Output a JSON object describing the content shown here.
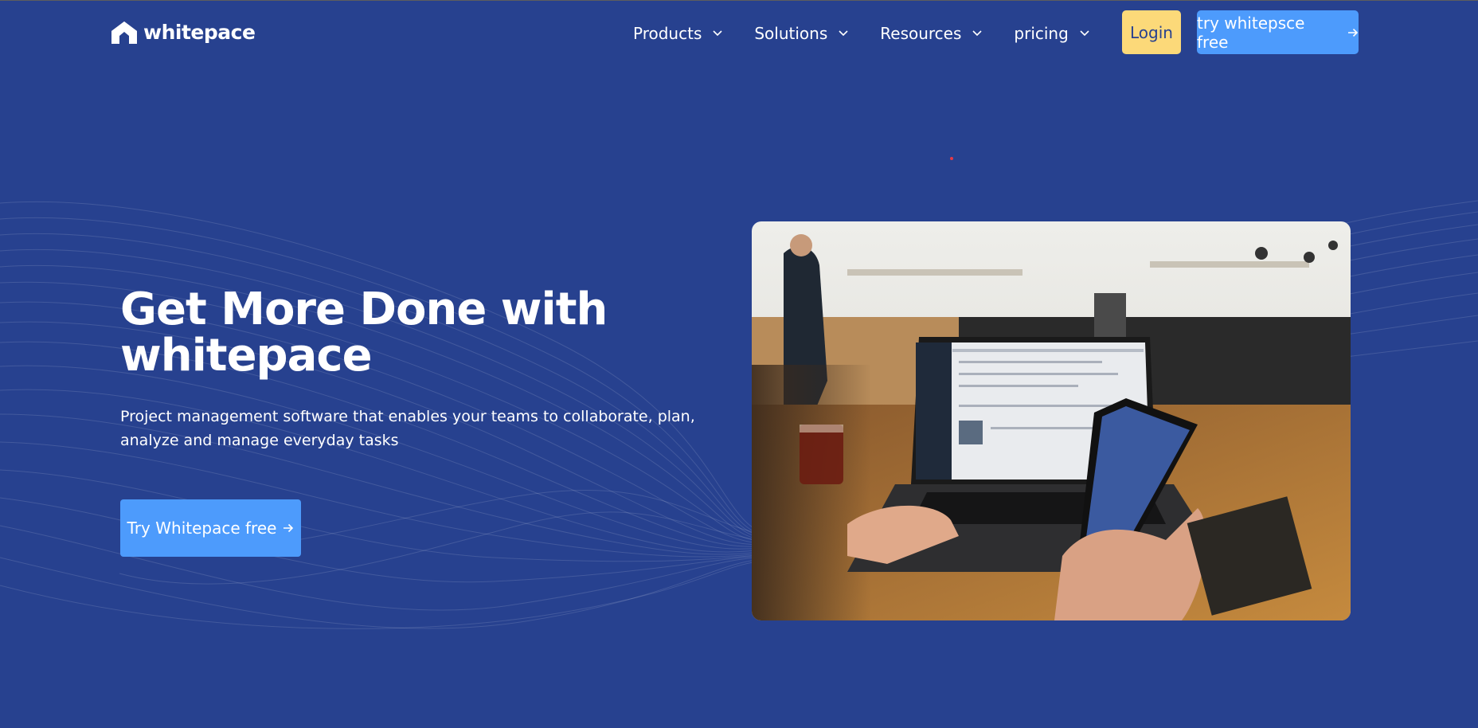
{
  "brand": {
    "name": "whitepace",
    "icon": "house-chevron-logo"
  },
  "nav": {
    "items": [
      {
        "label": "Products",
        "icon": "chevron-down-icon"
      },
      {
        "label": "Solutions",
        "icon": "chevron-down-icon"
      },
      {
        "label": "Resources",
        "icon": "chevron-down-icon"
      },
      {
        "label": "pricing",
        "icon": "chevron-down-icon"
      }
    ],
    "login_label": "Login",
    "cta_label": "try whitepsce free",
    "cta_icon": "arrow-right-icon"
  },
  "hero": {
    "title": "Get More Done with whitepace",
    "subtitle": "Project management software that enables your teams to collaborate, plan, analyze and manage everyday tasks",
    "cta_label": "Try Whitepace free",
    "cta_icon": "arrow-right-icon"
  },
  "colors": {
    "background": "#27418f",
    "login": "#fcd979",
    "cta": "#4d9bfc",
    "text": "#ffffff"
  }
}
